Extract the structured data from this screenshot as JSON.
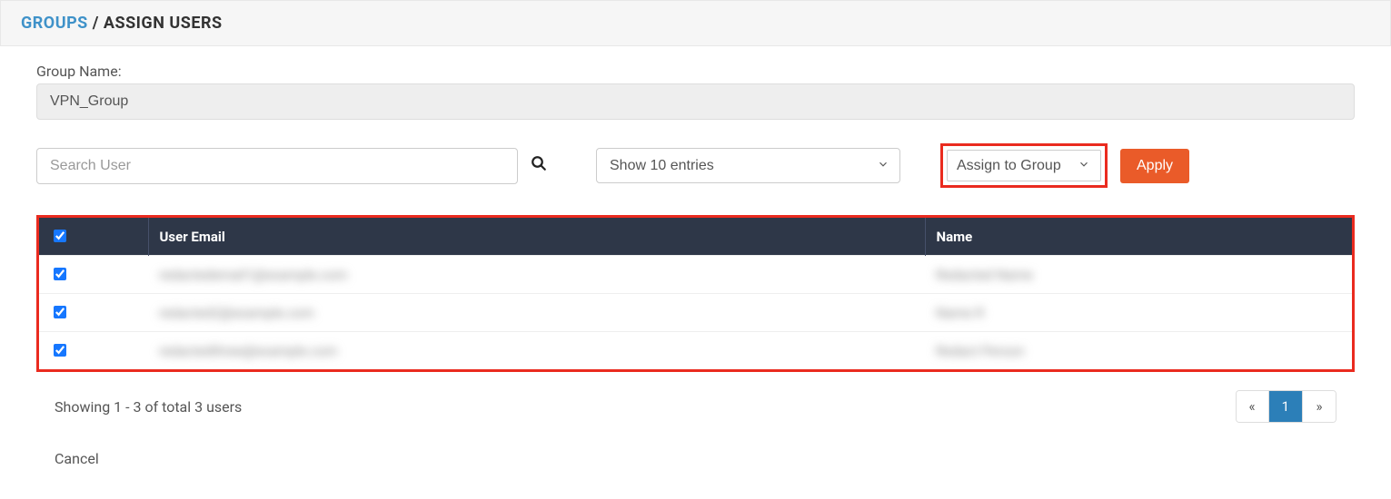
{
  "breadcrumb": {
    "parent": "Groups",
    "separator": " / ",
    "current": "Assign Users"
  },
  "group_name_label": "Group Name:",
  "group_name_value": "VPN_Group",
  "search_placeholder": "Search User",
  "entries_select": "Show 10 entries",
  "assign_select": "Assign to Group",
  "apply_label": "Apply",
  "table": {
    "headers": {
      "email": "User Email",
      "name": "Name"
    },
    "rows": [
      {
        "checked": true,
        "email": "redactedemail1@example.com",
        "name": "Redacted Name"
      },
      {
        "checked": true,
        "email": "redacted2@example.com",
        "name": "Name R"
      },
      {
        "checked": true,
        "email": "redactedthree@example.com",
        "name": "Redact Person"
      }
    ]
  },
  "showing_text": "Showing 1 - 3 of total 3 users",
  "pagination": {
    "prev": "«",
    "page": "1",
    "next": "»"
  },
  "cancel_label": "Cancel"
}
